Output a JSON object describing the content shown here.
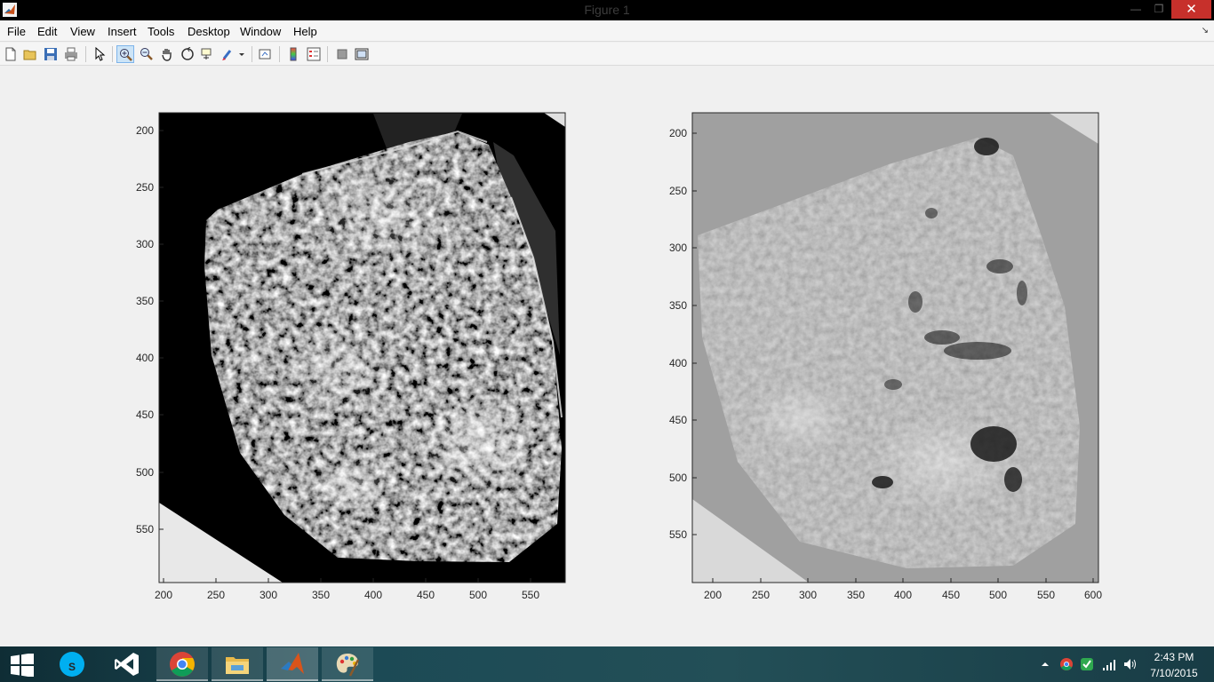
{
  "window": {
    "title": "Figure 1",
    "minimize_glyph": "—",
    "restore_glyph": "❐",
    "close_glyph": "✕"
  },
  "menu": {
    "items": [
      "File",
      "Edit",
      "View",
      "Insert",
      "Tools",
      "Desktop",
      "Window",
      "Help"
    ],
    "dock_glyph": "↘"
  },
  "toolbar": {
    "buttons": [
      "new-figure",
      "open-file",
      "save-figure",
      "print-figure",
      "edit-plot",
      "zoom-in",
      "zoom-out",
      "pan",
      "rotate-3d",
      "data-cursor",
      "brush",
      "link-plot",
      "insert-colorbar",
      "insert-legend",
      "hide-plot-tools",
      "show-plot-tools"
    ],
    "active": "zoom-in"
  },
  "plots": {
    "left": {
      "xticks": [
        "200",
        "250",
        "300",
        "350",
        "400",
        "450",
        "500",
        "550"
      ],
      "yticks": [
        "200",
        "250",
        "300",
        "350",
        "400",
        "450",
        "500",
        "550"
      ]
    },
    "right": {
      "xticks": [
        "200",
        "250",
        "300",
        "350",
        "400",
        "450",
        "500",
        "550",
        "600"
      ],
      "yticks": [
        "200",
        "250",
        "300",
        "350",
        "400",
        "450",
        "500",
        "550"
      ]
    }
  },
  "taskbar": {
    "apps": [
      "start",
      "skype",
      "visual-studio",
      "chrome",
      "file-explorer",
      "matlab",
      "paint"
    ],
    "active": "matlab"
  },
  "tray": {
    "time": "2:43 PM",
    "date": "7/10/2015"
  },
  "colors": {
    "titlebar": "#000000",
    "close_button": "#c7302b",
    "toolbar_active": "#cce4f7",
    "taskbar": "#1c4a55"
  }
}
